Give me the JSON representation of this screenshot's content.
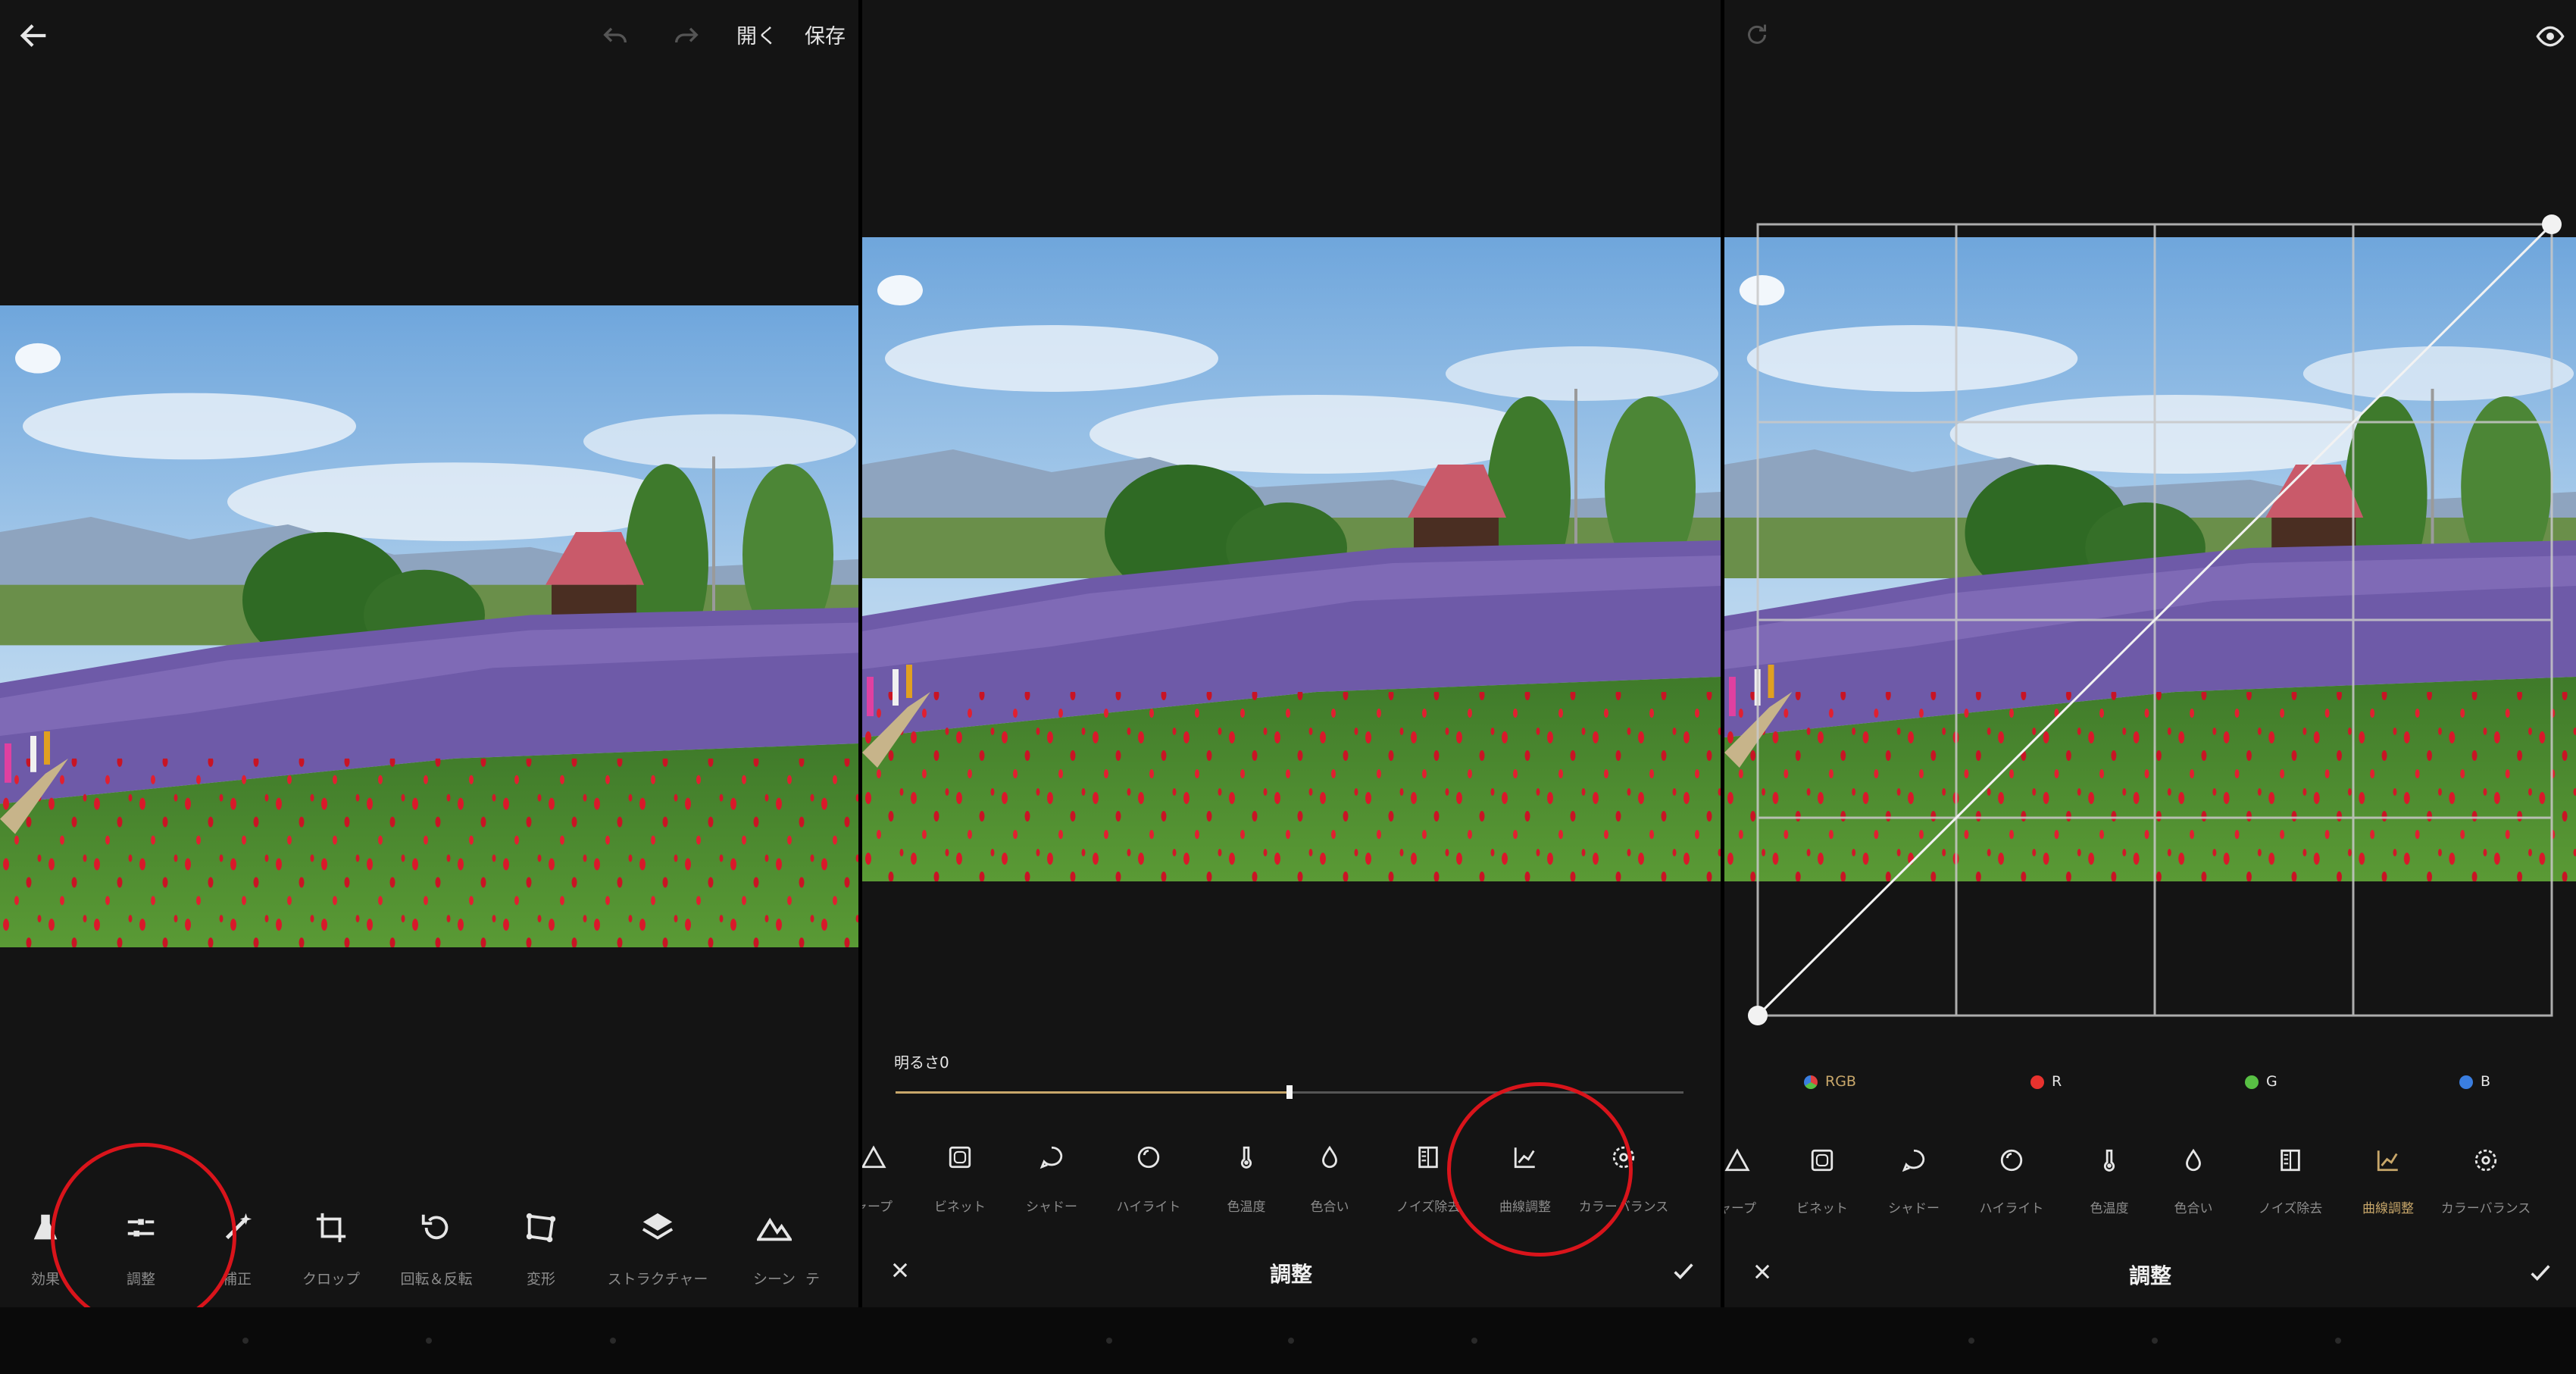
{
  "screen1": {
    "header": {
      "open_label": "開く",
      "save_label": "保存"
    },
    "tools": [
      "効果",
      "調整",
      "補正",
      "クロップ",
      "回転＆反転",
      "変形",
      "ストラクチャー",
      "シーン",
      "テ"
    ]
  },
  "screen2": {
    "slider": {
      "label": "明るさ",
      "value": "0",
      "level_fraction": 0.5
    },
    "tools": [
      "シャープ",
      "ビネット",
      "シャドー",
      "ハイライト",
      "色温度",
      "色合い",
      "ノイズ除去",
      "曲線調整",
      "カラーバランス"
    ],
    "title": "調整"
  },
  "screen3": {
    "channels": [
      "RGB",
      "R",
      "G",
      "B"
    ],
    "channel_colors": [
      "#e04040",
      "#e8322e",
      "#58c044",
      "#3a7ee0"
    ],
    "tools": [
      "シャープ",
      "ビネット",
      "シャドー",
      "ハイライト",
      "色温度",
      "色合い",
      "ノイズ除去",
      "曲線調整",
      "カラーバランス"
    ],
    "active_tool": "曲線調整",
    "title": "調整"
  },
  "colors": {
    "accent": "#c8a76a",
    "annotation": "#d9141b",
    "background": "#141414"
  },
  "icons": [
    "back-arrow-icon",
    "undo-icon",
    "redo-icon",
    "eye-icon",
    "reset-icon",
    "close-icon",
    "check-icon"
  ]
}
